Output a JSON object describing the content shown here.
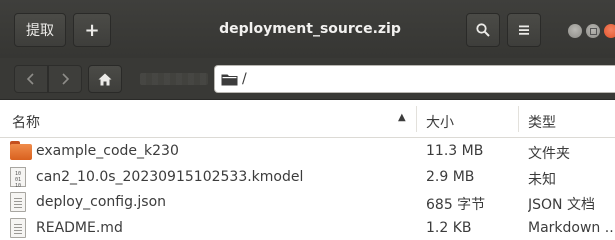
{
  "header": {
    "extract_label": "提取",
    "add_label": "+",
    "title": "deployment_source.zip",
    "search_icon": "search-icon",
    "menu_icon": "hamburger-menu-icon"
  },
  "location": {
    "back_icon": "chevron-left-icon",
    "forward_icon": "chevron-right-icon",
    "home_icon": "home-icon",
    "path": "/"
  },
  "columns": {
    "name": "名称",
    "size": "大小",
    "type": "类型"
  },
  "files": [
    {
      "name": "example_code_k230",
      "size": "11.3 MB",
      "type": "文件夹",
      "icon": "folder-icon"
    },
    {
      "name": "can2_10.0s_20230915102533.kmodel",
      "size": "2.9 MB",
      "type": "未知",
      "icon": "binary-file-icon"
    },
    {
      "name": "deploy_config.json",
      "size": "685 字节",
      "type": "JSON 文档",
      "icon": "text-file-icon"
    },
    {
      "name": "README.md",
      "size": "1.2 KB",
      "type": "Markdown ...",
      "icon": "text-file-icon"
    }
  ],
  "colors": {
    "headerbar": "#3c3c39",
    "close_button": "#e9562c",
    "folder": "#e8752f"
  }
}
